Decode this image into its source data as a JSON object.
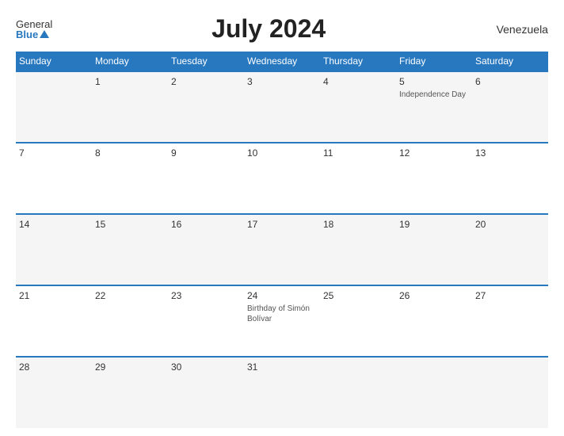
{
  "header": {
    "logo_general": "General",
    "logo_blue": "Blue",
    "title": "July 2024",
    "country": "Venezuela"
  },
  "weekdays": [
    "Sunday",
    "Monday",
    "Tuesday",
    "Wednesday",
    "Thursday",
    "Friday",
    "Saturday"
  ],
  "weeks": [
    [
      {
        "day": "",
        "event": ""
      },
      {
        "day": "1",
        "event": ""
      },
      {
        "day": "2",
        "event": ""
      },
      {
        "day": "3",
        "event": ""
      },
      {
        "day": "4",
        "event": ""
      },
      {
        "day": "5",
        "event": "Independence Day"
      },
      {
        "day": "6",
        "event": ""
      }
    ],
    [
      {
        "day": "7",
        "event": ""
      },
      {
        "day": "8",
        "event": ""
      },
      {
        "day": "9",
        "event": ""
      },
      {
        "day": "10",
        "event": ""
      },
      {
        "day": "11",
        "event": ""
      },
      {
        "day": "12",
        "event": ""
      },
      {
        "day": "13",
        "event": ""
      }
    ],
    [
      {
        "day": "14",
        "event": ""
      },
      {
        "day": "15",
        "event": ""
      },
      {
        "day": "16",
        "event": ""
      },
      {
        "day": "17",
        "event": ""
      },
      {
        "day": "18",
        "event": ""
      },
      {
        "day": "19",
        "event": ""
      },
      {
        "day": "20",
        "event": ""
      }
    ],
    [
      {
        "day": "21",
        "event": ""
      },
      {
        "day": "22",
        "event": ""
      },
      {
        "day": "23",
        "event": ""
      },
      {
        "day": "24",
        "event": "Birthday of Simón Bolívar"
      },
      {
        "day": "25",
        "event": ""
      },
      {
        "day": "26",
        "event": ""
      },
      {
        "day": "27",
        "event": ""
      }
    ],
    [
      {
        "day": "28",
        "event": ""
      },
      {
        "day": "29",
        "event": ""
      },
      {
        "day": "30",
        "event": ""
      },
      {
        "day": "31",
        "event": ""
      },
      {
        "day": "",
        "event": ""
      },
      {
        "day": "",
        "event": ""
      },
      {
        "day": "",
        "event": ""
      }
    ]
  ]
}
